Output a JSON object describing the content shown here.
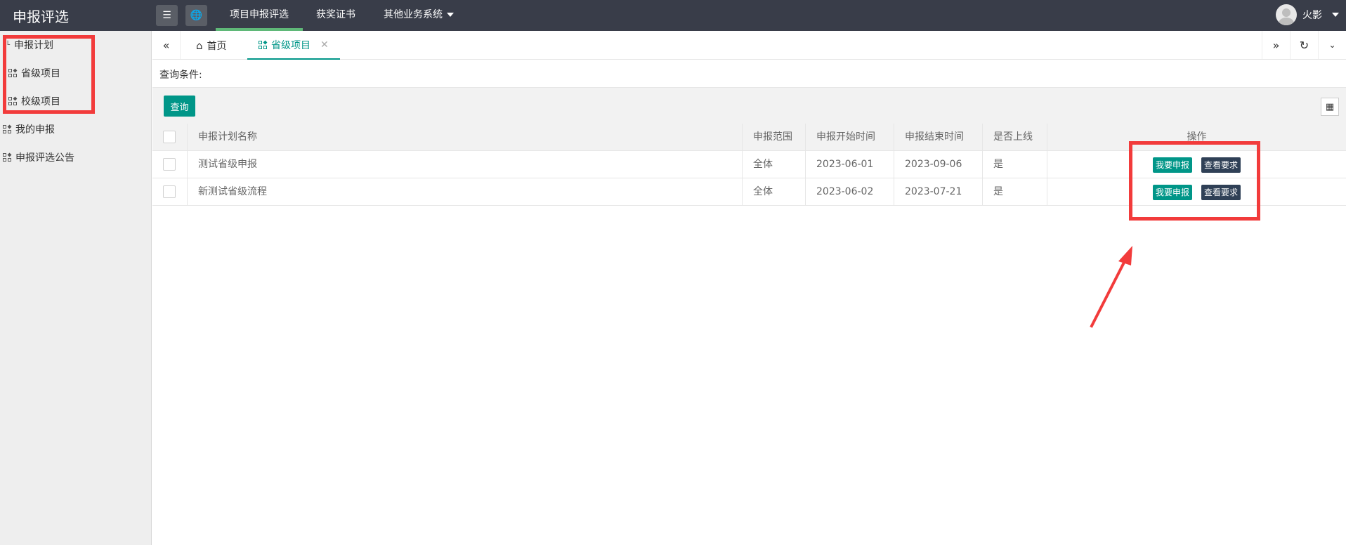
{
  "header": {
    "title": "申报评选",
    "nav": [
      {
        "label": "项目申报评选",
        "active": true
      },
      {
        "label": "获奖证书",
        "active": false
      },
      {
        "label": "其他业务系统",
        "active": false,
        "dropdown": true
      }
    ],
    "user_name": "火影"
  },
  "sidebar": {
    "items": [
      {
        "label": "申报计划"
      },
      {
        "label": "省级项目"
      },
      {
        "label": "校级项目"
      },
      {
        "label": "我的申报"
      },
      {
        "label": "申报评选公告"
      }
    ]
  },
  "tabs": [
    {
      "label": "首页",
      "icon": "home-icon"
    },
    {
      "label": "省级项目",
      "icon": "grid-icon",
      "active": true
    }
  ],
  "query": {
    "label": "查询条件:",
    "button": "查询"
  },
  "table": {
    "columns": [
      "申报计划名称",
      "申报范围",
      "申报开始时间",
      "申报结束时间",
      "是否上线",
      "操作"
    ],
    "rows": [
      {
        "name": "测试省级申报",
        "scope": "全体",
        "start": "2023-06-01",
        "end": "2023-09-06",
        "online": "是",
        "apply": "我要申报",
        "view": "查看要求"
      },
      {
        "name": "新测试省级流程",
        "scope": "全体",
        "start": "2023-06-02",
        "end": "2023-07-21",
        "online": "是",
        "apply": "我要申报",
        "view": "查看要求"
      }
    ]
  },
  "colors": {
    "header_bg": "#393D49",
    "accent": "#009688",
    "dark_button": "#2F4056",
    "annotation": "#f23b3b"
  }
}
